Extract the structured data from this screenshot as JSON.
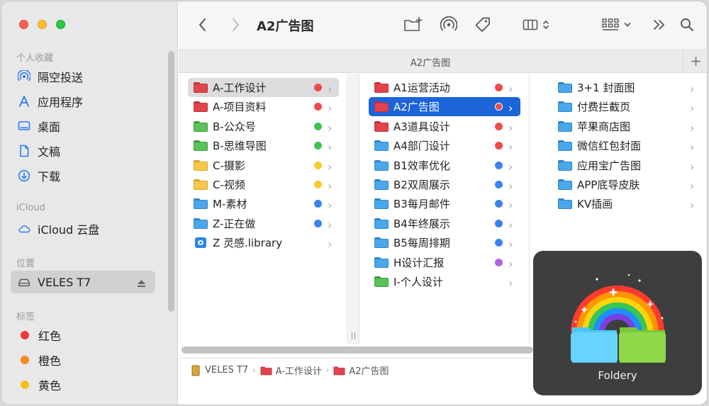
{
  "sidebar": {
    "favorites_header": "个人收藏",
    "favorites": [
      {
        "label": "隔空投送",
        "icon": "airdrop-icon"
      },
      {
        "label": "应用程序",
        "icon": "applications-icon"
      },
      {
        "label": "桌面",
        "icon": "desktop-icon"
      },
      {
        "label": "文稿",
        "icon": "document-icon"
      },
      {
        "label": "下载",
        "icon": "download-icon"
      }
    ],
    "icloud_header": "iCloud",
    "icloud": [
      {
        "label": "iCloud 云盘",
        "icon": "cloud-icon"
      }
    ],
    "locations_header": "位置",
    "locations": [
      {
        "label": "VELES T7",
        "icon": "drive-icon",
        "eject_icon": "eject-icon"
      }
    ],
    "tags_header": "标签",
    "tags": [
      {
        "label": "红色",
        "color": "#f2383a"
      },
      {
        "label": "橙色",
        "color": "#f5871f"
      },
      {
        "label": "黄色",
        "color": "#f5c01f"
      }
    ]
  },
  "toolbar": {
    "title": "A2广告图",
    "icons": [
      "back-icon",
      "forward-icon",
      "new-folder-icon",
      "airdrop-icon",
      "tag-icon",
      "column-view-icon",
      "group-icon",
      "more-icon",
      "search-icon"
    ]
  },
  "tabbar": {
    "title": "A2广告图",
    "plus": "+"
  },
  "columns": [
    {
      "rows": [
        {
          "label": "A-工作设计",
          "folder_color": "red",
          "tag": "#ef4b4b"
        },
        {
          "label": "A-项目资料",
          "folder_color": "red",
          "tag": "#ef4b4b"
        },
        {
          "label": "B-公众号",
          "folder_color": "green",
          "tag": "#3fc256"
        },
        {
          "label": "B-思维导图",
          "folder_color": "green",
          "tag": "#3fc256"
        },
        {
          "label": "C-摄影",
          "folder_color": "yellow",
          "tag": "#f5cc2a"
        },
        {
          "label": "C-视频",
          "folder_color": "yellow",
          "tag": "#f5cc2a"
        },
        {
          "label": "M-素材",
          "folder_color": "blue",
          "tag": "#3b82f0"
        },
        {
          "label": "Z-正在做",
          "folder_color": "blue",
          "tag": "#3b82f0"
        },
        {
          "label": "Z 灵感.library",
          "folder_color": "app",
          "tag": null
        }
      ]
    },
    {
      "rows": [
        {
          "label": "A1运营活动",
          "folder_color": "red",
          "tag": "#ef4b4b"
        },
        {
          "label": "A2广告图",
          "folder_color": "red",
          "tag": "#ef4b4b"
        },
        {
          "label": "A3道具设计",
          "folder_color": "red",
          "tag": "#ef4b4b"
        },
        {
          "label": "A4部门设计",
          "folder_color": "blue",
          "tag": "#ef4b4b"
        },
        {
          "label": "B1效率优化",
          "folder_color": "blue",
          "tag": "#3b82f0"
        },
        {
          "label": "B2双周展示",
          "folder_color": "blue",
          "tag": "#3b82f0"
        },
        {
          "label": "B3每月邮件",
          "folder_color": "blue",
          "tag": "#3b82f0"
        },
        {
          "label": "B4年终展示",
          "folder_color": "blue",
          "tag": "#3b82f0"
        },
        {
          "label": "B5每周排期",
          "folder_color": "blue",
          "tag": "#3b82f0"
        },
        {
          "label": "H设计汇报",
          "folder_color": "blue",
          "tag": "#b664e0"
        },
        {
          "label": "I-个人设计",
          "folder_color": "green",
          "tag": null
        }
      ]
    },
    {
      "rows": [
        {
          "label": "3+1 封面图",
          "folder_color": "blue",
          "tag": null
        },
        {
          "label": "付费拦截页",
          "folder_color": "blue",
          "tag": null
        },
        {
          "label": "苹果商店图",
          "folder_color": "blue",
          "tag": null
        },
        {
          "label": "微信红包封面",
          "folder_color": "blue",
          "tag": null
        },
        {
          "label": "应用宝广告图",
          "folder_color": "blue",
          "tag": null
        },
        {
          "label": "APP底导皮肤",
          "folder_color": "blue",
          "tag": null
        },
        {
          "label": "KV插画",
          "folder_color": "blue",
          "tag": null
        }
      ]
    }
  ],
  "pathbar": [
    {
      "label": "VELES T7",
      "icon": "drive-icon"
    },
    {
      "label": "A-工作设计",
      "icon": "folder-icon"
    },
    {
      "label": "A2广告图",
      "icon": "folder-icon"
    }
  ],
  "foldery": {
    "label": "Foldery"
  }
}
